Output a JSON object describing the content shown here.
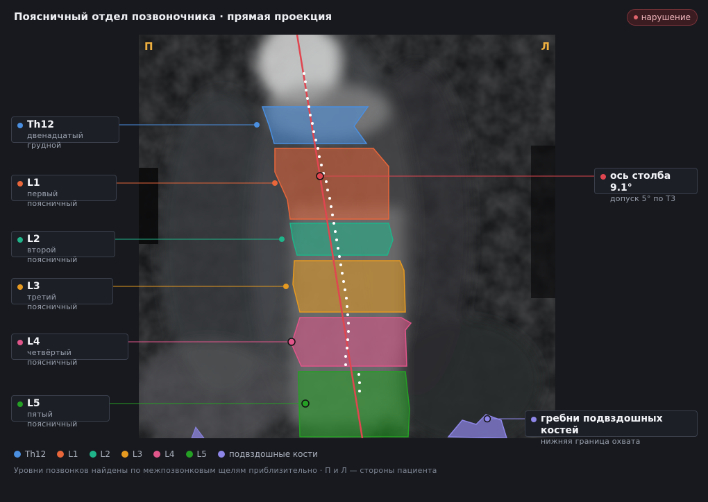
{
  "header": {
    "title": "Поясничный отдел позвоночника · прямая проекция",
    "badge": "нарушение"
  },
  "viewer": {
    "side_right": "П",
    "side_left": "Л"
  },
  "colors": {
    "Th12": "#4a8fe0",
    "L1": "#e8663a",
    "L2": "#1fb489",
    "L3": "#e79a20",
    "L4": "#e0558a",
    "L5": "#25a025",
    "iliac": "#8e86e8",
    "axis": "#e04650"
  },
  "callouts": {
    "Th12": {
      "title": "Th12",
      "subtitle": "двенадцатый грудной"
    },
    "L1": {
      "title": "L1",
      "subtitle": "первый поясничный"
    },
    "L2": {
      "title": "L2",
      "subtitle": "второй поясничный"
    },
    "L3": {
      "title": "L3",
      "subtitle": "третий поясничный"
    },
    "L4": {
      "title": "L4",
      "subtitle": "четвёртый поясничный"
    },
    "L5": {
      "title": "L5",
      "subtitle": "пятый поясничный"
    },
    "axis": {
      "title": "ось столба 9.1°",
      "subtitle": "допуск 5° по Т3"
    },
    "iliac": {
      "title": "гребни подвздошных костей",
      "subtitle": "нижняя граница охвата"
    }
  },
  "legend": [
    {
      "label": "Th12",
      "color": "#4a8fe0"
    },
    {
      "label": "L1",
      "color": "#e8663a"
    },
    {
      "label": "L2",
      "color": "#1fb489"
    },
    {
      "label": "L3",
      "color": "#e79a20"
    },
    {
      "label": "L4",
      "color": "#e0558a"
    },
    {
      "label": "L5",
      "color": "#25a025"
    },
    {
      "label": "подвздошные кости",
      "color": "#8e86e8"
    }
  ],
  "footnote": "Уровни позвонков найдены по межпозвонковым щелям приблизительно · П и Л — стороны пациента"
}
